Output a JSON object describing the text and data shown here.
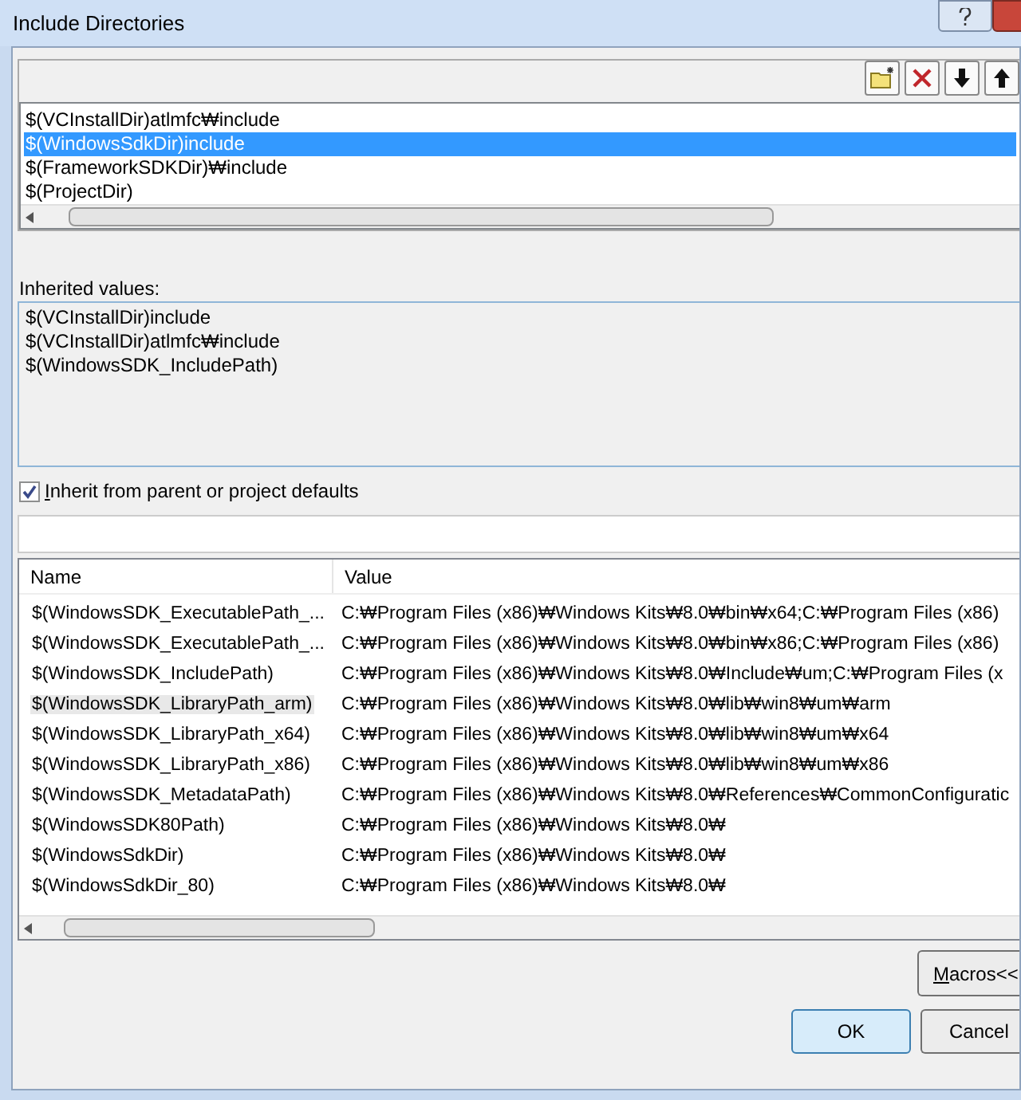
{
  "window": {
    "title": "Include Directories"
  },
  "toolbar": [
    {
      "kind": "new-folder"
    },
    {
      "kind": "delete"
    },
    {
      "kind": "move-down"
    },
    {
      "kind": "move-up"
    }
  ],
  "directories": [
    {
      "text": "$(VCInstallDir)atlmfc₩include",
      "selected": false
    },
    {
      "text": "$(WindowsSdkDir)include",
      "selected": true
    },
    {
      "text": "$(FrameworkSDKDir)₩include",
      "selected": false
    },
    {
      "text": "$(ProjectDir)",
      "selected": false
    }
  ],
  "inherited": {
    "label": "Inherited values:",
    "values": [
      "$(VCInstallDir)include",
      "$(VCInstallDir)atlmfc₩include",
      "$(WindowsSDK_IncludePath)"
    ]
  },
  "inherit_checkbox": {
    "label": "Inherit from parent or project defaults",
    "checked": true
  },
  "macros": {
    "columns": [
      "Name",
      "Value"
    ],
    "rows": [
      {
        "name": "$(WindowsSDK_ExecutablePath_...",
        "value": "C:₩Program Files (x86)₩Windows Kits₩8.0₩bin₩x64;C:₩Program Files (x86)",
        "selected": false
      },
      {
        "name": "$(WindowsSDK_ExecutablePath_...",
        "value": "C:₩Program Files (x86)₩Windows Kits₩8.0₩bin₩x86;C:₩Program Files (x86)",
        "selected": false
      },
      {
        "name": "$(WindowsSDK_IncludePath)",
        "value": "C:₩Program Files (x86)₩Windows Kits₩8.0₩Include₩um;C:₩Program Files (x",
        "selected": false
      },
      {
        "name": "$(WindowsSDK_LibraryPath_arm)",
        "value": "C:₩Program Files (x86)₩Windows Kits₩8.0₩lib₩win8₩um₩arm",
        "selected": true
      },
      {
        "name": "$(WindowsSDK_LibraryPath_x64)",
        "value": "C:₩Program Files (x86)₩Windows Kits₩8.0₩lib₩win8₩um₩x64",
        "selected": false
      },
      {
        "name": "$(WindowsSDK_LibraryPath_x86)",
        "value": "C:₩Program Files (x86)₩Windows Kits₩8.0₩lib₩win8₩um₩x86",
        "selected": false
      },
      {
        "name": "$(WindowsSDK_MetadataPath)",
        "value": "C:₩Program Files (x86)₩Windows Kits₩8.0₩References₩CommonConfiguratic",
        "selected": false
      },
      {
        "name": "$(WindowsSDK80Path)",
        "value": "C:₩Program Files (x86)₩Windows Kits₩8.0₩",
        "selected": false
      },
      {
        "name": "$(WindowsSdkDir)",
        "value": "C:₩Program Files (x86)₩Windows Kits₩8.0₩",
        "selected": false
      },
      {
        "name": "$(WindowsSdkDir_80)",
        "value": "C:₩Program Files (x86)₩Windows Kits₩8.0₩",
        "selected": false
      }
    ]
  },
  "buttons": {
    "macros": "Macros<<",
    "ok": "OK",
    "cancel": "Cancel"
  }
}
